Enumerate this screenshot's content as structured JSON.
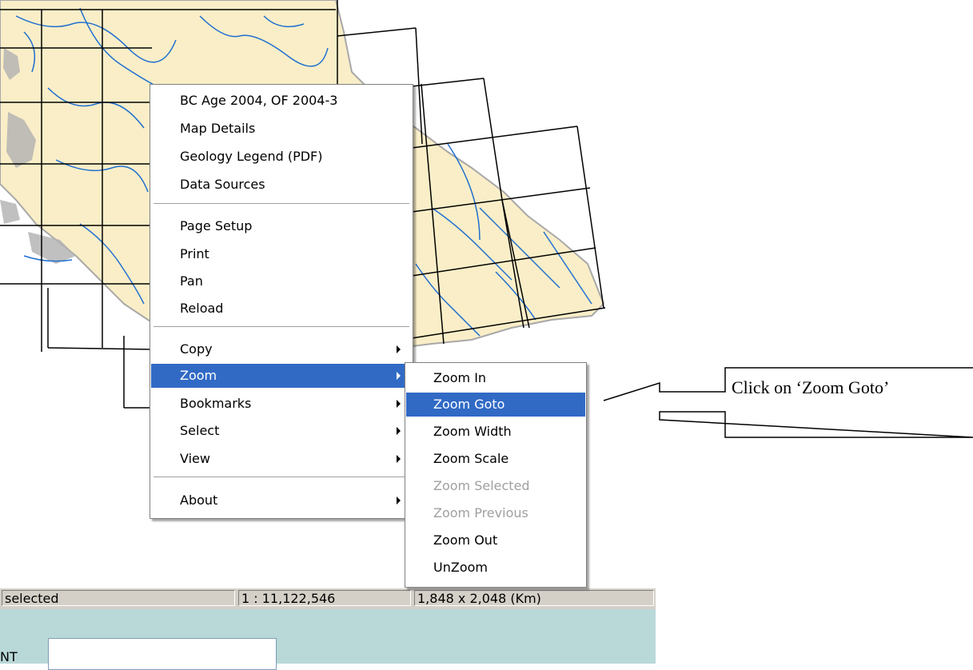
{
  "context_menu": {
    "items": [
      {
        "label": "BC Age 2004, OF 2004-3"
      },
      {
        "label": "Map Details"
      },
      {
        "label": "Geology Legend (PDF)"
      },
      {
        "label": "Data Sources"
      },
      {
        "label": "Page Setup"
      },
      {
        "label": "Print"
      },
      {
        "label": "Pan"
      },
      {
        "label": "Reload"
      },
      {
        "label": "Copy",
        "submenu": true
      },
      {
        "label": "Zoom",
        "submenu": true,
        "highlighted": true
      },
      {
        "label": "Bookmarks",
        "submenu": true
      },
      {
        "label": "Select",
        "submenu": true
      },
      {
        "label": "View",
        "submenu": true
      },
      {
        "label": "About",
        "submenu": true
      }
    ]
  },
  "zoom_submenu": {
    "items": [
      {
        "label": "Zoom In"
      },
      {
        "label": "Zoom Goto",
        "highlighted": true
      },
      {
        "label": "Zoom Width"
      },
      {
        "label": "Zoom Scale"
      },
      {
        "label": "Zoom Selected",
        "disabled": true
      },
      {
        "label": "Zoom Previous",
        "disabled": true
      },
      {
        "label": "Zoom Out"
      },
      {
        "label": "UnZoom"
      }
    ]
  },
  "status_bar": {
    "selection": "selected",
    "scale": "1 : 11,122,546",
    "extent": "1,848 x 2,048 (Km)"
  },
  "lower_panel": {
    "label_fragment": "NT"
  },
  "callout": {
    "text": "Click on ‘Zoom Goto’"
  },
  "colors": {
    "land": "#faeec8",
    "rivers": "#1f6fd0",
    "coast": "#a8a8a8",
    "grid": "#000000",
    "highlight": "#316ac5",
    "statusbar": "#d4d0c8",
    "lower_panel": "#b9d8d8"
  }
}
